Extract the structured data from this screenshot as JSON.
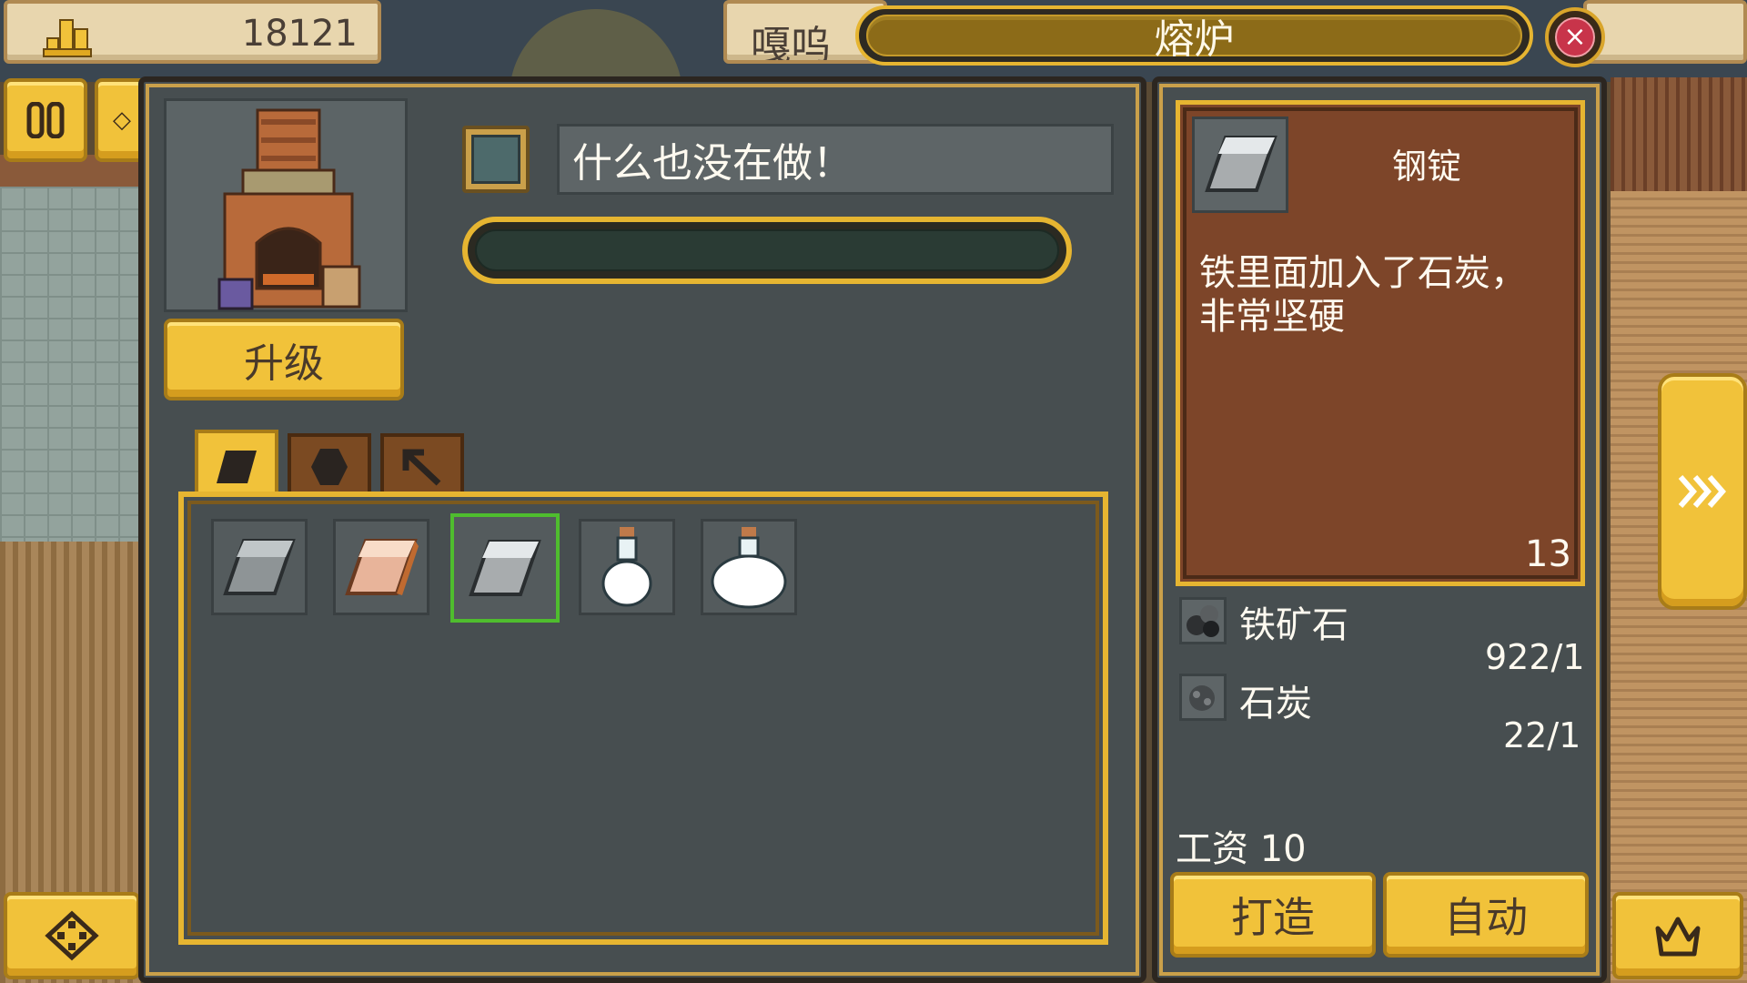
{
  "hud": {
    "gold_icon": "gold-coins-icon",
    "gold": "18121",
    "player_name": "嘎呜",
    "pause_icon": "pause-icon",
    "compass_icon": "compass-icon",
    "crown_icon": "crown-icon",
    "next_icon": "fast-forward-icon"
  },
  "window": {
    "title": "熔炉",
    "close_label": "×"
  },
  "furnace": {
    "image": "furnace-icon",
    "status_text": "什么也没在做！",
    "progress": 0,
    "upgrade_label": "升级"
  },
  "tabs": [
    {
      "icon": "ingot-tab-icon",
      "active": true
    },
    {
      "icon": "gem-tab-icon",
      "active": false
    },
    {
      "icon": "pickaxe-tab-icon",
      "active": false
    }
  ],
  "recipes": [
    {
      "icon": "iron-ingot-icon",
      "selected": false
    },
    {
      "icon": "copper-ingot-icon",
      "selected": false
    },
    {
      "icon": "steel-ingot-icon",
      "selected": true
    },
    {
      "icon": "small-potion-icon",
      "selected": false
    },
    {
      "icon": "large-potion-icon",
      "selected": false
    }
  ],
  "detail": {
    "name": "钢锭",
    "description_line1": "铁里面加入了石炭，",
    "description_line2": "非常坚硬",
    "count": "13",
    "materials": [
      {
        "icon": "iron-ore-icon",
        "name": "铁矿石",
        "amount": "922/1"
      },
      {
        "icon": "coal-icon",
        "name": "石炭",
        "amount": "22/1"
      }
    ],
    "wage": "工资 10",
    "craft_label": "打造",
    "auto_label": "自动"
  },
  "colors": {
    "gold_button": "#f1c23a",
    "panel_bg": "#474e50",
    "detail_bg": "#7d4529",
    "selected_outline": "#4fbd2e",
    "close_red": "#c8344a"
  }
}
